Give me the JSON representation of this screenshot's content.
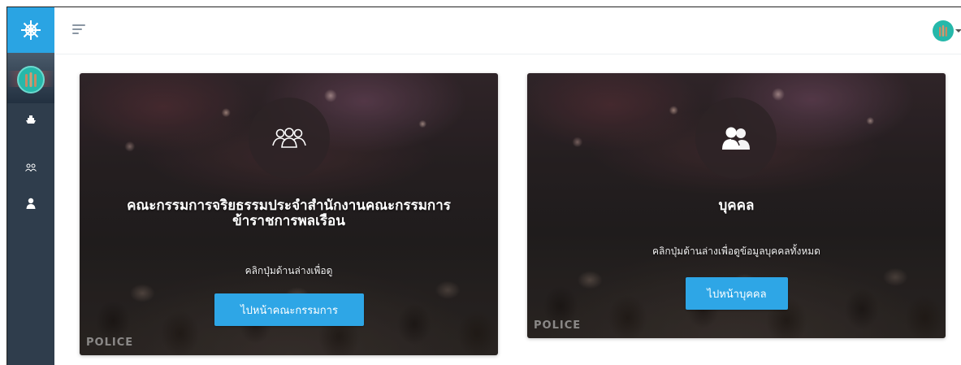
{
  "sidebar": {
    "logo_icon": "ship-wheel-icon",
    "items": [
      {
        "name": "ship-icon"
      },
      {
        "name": "group-icon"
      },
      {
        "name": "person-icon"
      }
    ]
  },
  "topbar": {
    "menu_icon": "hamburger-menu-icon",
    "user_menu": "user-avatar"
  },
  "cards": [
    {
      "title_line1": "คณะกรรมการจริยธรรมประจำสำนักงานคณะกรรมการ",
      "title_line2": "ข้าราชการพลเรือน",
      "description": "คลิกปุ่มด้านล่างเพื่อดู",
      "button_label": "ไปหน้าคณะกรรมการ",
      "icon": "committee-group-icon"
    },
    {
      "title_line1": "บุคคล",
      "description": "คลิกปุ่มด้านล่างเพื่อดูข้อมูลบุคคลทั้งหมด",
      "button_label": "ไปหน้าบุคคล",
      "icon": "users-icon"
    }
  ],
  "colors": {
    "sidebar_bg": "#2f3d4c",
    "logo_bg": "#2aa4e3",
    "button_bg": "#2ea6e6",
    "avatar_bg": "#26b8aa"
  },
  "background_text": "POLICE"
}
